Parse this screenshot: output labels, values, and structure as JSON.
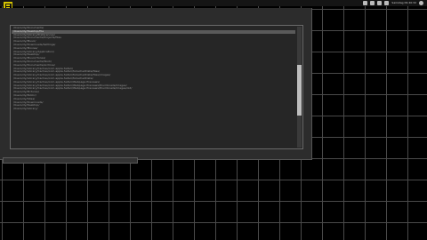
{
  "system_tray": {
    "items": [
      {
        "icon": "square-icon"
      },
      {
        "icon": "window-icon"
      },
      {
        "icon": "bell-icon"
      },
      {
        "icon": "pin-icon"
      }
    ],
    "clock_text": "Samstag 09:40:32",
    "power_icon": "power-icon"
  },
  "app": {
    "logo_icon": "app-logo-icon",
    "logo_color": "#d6c400"
  },
  "file_list": {
    "selected_index": 1,
    "scroll_position": 0.55,
    "scroll_visible_fraction": 0.42,
    "items": [
      "/Users/dy/Documents/",
      "/Users/dy/Desktop/file",
      "/Users/dy/Library/Preferences/",
      "/Users/dy/Documents/Projects/files",
      "/Users/dy/Music/",
      "/Users/dy/Downloads/Settings/",
      "/Users/dy/Movies/",
      "/Users/dy/Library/Application/",
      "/Users/dy/Desktop/",
      "/Users/dy/Music/iTunes/",
      "/Users/dy/Documents/Work/",
      "/Users/dy/Documents/Archive/",
      "/Users/dy/Library/Caches/com.apple.Safari/",
      "/Users/dy/Library/Caches/com.apple.Safari/fsCachedData/files/",
      "/Users/dy/Library/Caches/com.apple.Safari/fsCachedData/files/images/",
      "/Users/dy/Library/Caches/com.apple.Safari/fsCachedData/",
      "/Users/dy/Library/Caches/com.apple.Safari/Webpage Previews/",
      "/Users/dy/Library/Caches/com.apple.Safari/Webpage Previews/thumbnails/images/",
      "/Users/dy/Library/Caches/com.apple.Safari/Webpage Previews/thumbnails/images/old/",
      "/Users/dy/Pictures/",
      "/Users/dy/Public/",
      "/Users/dy/Sites/",
      "/Users/dy/Downloads/",
      "/Users/dy/Desktop/",
      "/Users/dy/Library/"
    ]
  },
  "bottom_field": {
    "value": ""
  }
}
